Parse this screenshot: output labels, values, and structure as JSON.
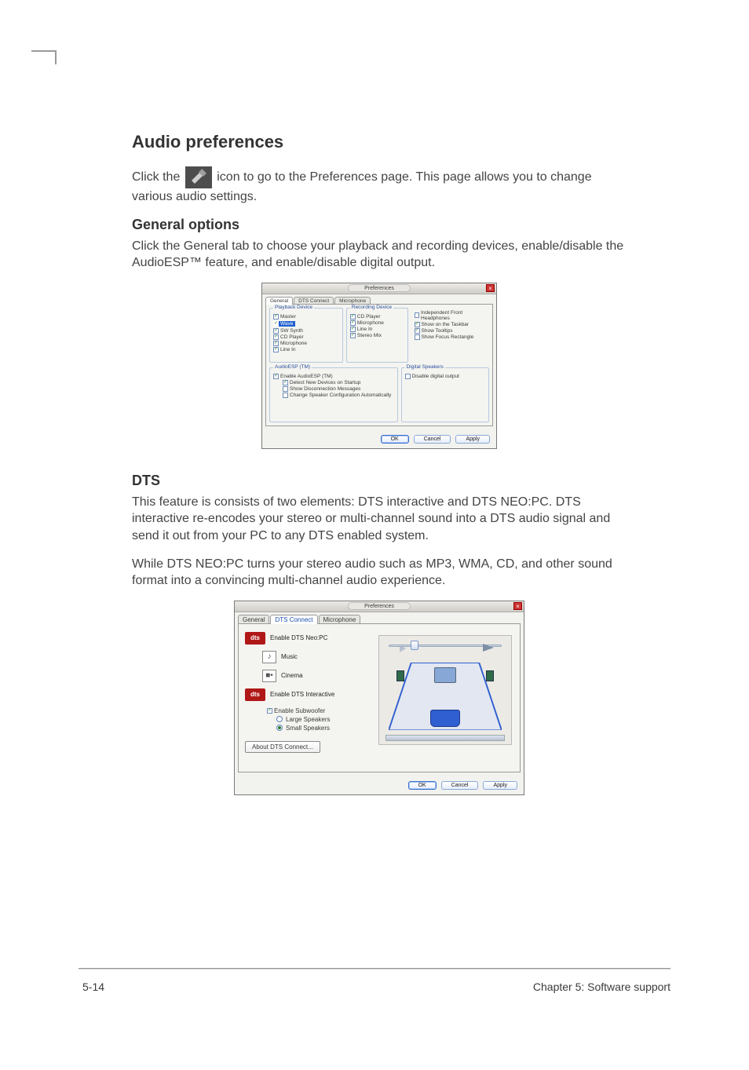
{
  "headings": {
    "audio_prefs": "Audio preferences",
    "general_options": "General options",
    "dts": "DTS"
  },
  "paragraphs": {
    "click_the": "Click the ",
    "after_icon": " icon to go to the Preferences page. This page allows you to change various audio settings.",
    "general_body": "Click the General tab to choose your playback and recording devices, enable/disable the AudioESP™ feature, and enable/disable digital output.",
    "dts_p1": "This feature is consists of two elements: DTS interactive and DTS NEO:PC. DTS interactive re-encodes your stereo or multi-channel sound into a DTS audio signal and send it out from your PC to any DTS enabled system.",
    "dts_p2": "While DTS NEO:PC turns your stereo audio such as MP3, WMA, CD, and other sound format into a convincing multi-channel audio experience."
  },
  "dialog1": {
    "title": "Preferences",
    "tabs": {
      "general": "General",
      "dts": "DTS Connect",
      "mic": "Microphone"
    },
    "playback": {
      "legend": "Playback Device",
      "items": [
        "Master",
        "Wave",
        "SW Synth",
        "CD Player",
        "Microphone",
        "Line In"
      ],
      "checked": [
        true,
        true,
        true,
        true,
        true,
        true
      ],
      "highlight_index": 1
    },
    "recording": {
      "legend": "Recording Device",
      "items": [
        "CD Player",
        "Microphone",
        "Line In",
        "Stereo Mix"
      ],
      "checked": [
        true,
        true,
        true,
        true
      ]
    },
    "options": {
      "items": [
        "Independent Front Headphones",
        "Show on the Taskbar",
        "Show Tooltips",
        "Show Focus Rectangle"
      ],
      "checked": [
        false,
        true,
        true,
        false
      ]
    },
    "audioesp": {
      "legend": "AudioESP (TM)",
      "enable": "Enable AudioESP (TM)",
      "detect": "Detect New Devices on Startup",
      "showdisc": "Show Disconnection Messages",
      "changecfg": "Change Speaker Configuration Automatically",
      "checked": {
        "enable": true,
        "detect": true,
        "showdisc": false,
        "changecfg": false
      }
    },
    "digital": {
      "legend": "Digital Speakers",
      "item": "Disable digital output",
      "checked": false
    },
    "buttons": {
      "ok": "OK",
      "cancel": "Cancel",
      "apply": "Apply"
    }
  },
  "dialog2": {
    "title": "Preferences",
    "tabs": {
      "general": "General",
      "dts": "DTS Connect",
      "mic": "Microphone"
    },
    "neo": {
      "badge": "dts",
      "label": "Enable DTS Neo:PC"
    },
    "music": "Music",
    "cinema": "Cinema",
    "interactive": {
      "badge": "dts",
      "label": "Enable DTS Interactive"
    },
    "sub": {
      "label": "Enable Subwoofer",
      "checked": true
    },
    "radios": {
      "large": "Large Speakers",
      "small": "Small Speakers",
      "selected": "small"
    },
    "about": "About DTS Connect...",
    "buttons": {
      "ok": "OK",
      "cancel": "Cancel",
      "apply": "Apply"
    }
  },
  "footer": {
    "left": "5-14",
    "right": "Chapter 5: Software support"
  }
}
